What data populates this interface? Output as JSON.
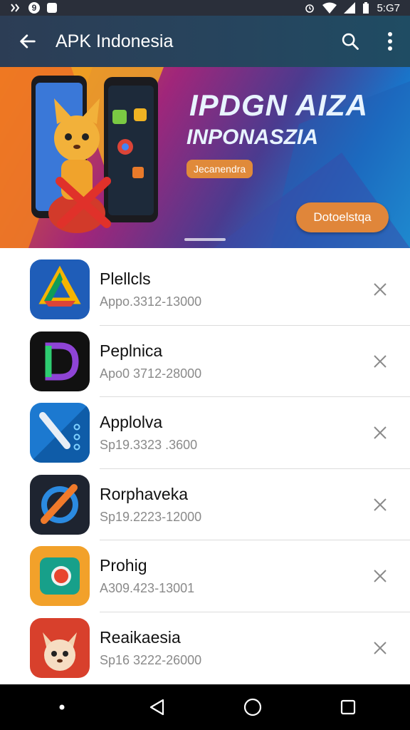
{
  "status_bar": {
    "left_icons": [
      "notification-icon",
      "circle-9-icon",
      "screenshot-icon"
    ],
    "circle_badge": "9",
    "time": "5:G7"
  },
  "app_bar": {
    "title": "APK Indonesia"
  },
  "banner": {
    "headline": "IPDGN AIZA",
    "subheadline": "INPONASZIA",
    "chip_label": "Jecanendra",
    "cta_label": "Dotoelstqa"
  },
  "apps": [
    {
      "name": "Plellcls",
      "meta": "Appo.3312-13000",
      "icon": "drive-icon"
    },
    {
      "name": "Peplnica",
      "meta": "Apo0 3712-28000",
      "icon": "d-letter-icon"
    },
    {
      "name": "Applolva",
      "meta": "Sp19.3323 .3600",
      "icon": "pen-icon"
    },
    {
      "name": "Rorphaveka",
      "meta": "Sp19.2223-12000",
      "icon": "fox-pen-icon"
    },
    {
      "name": "Prohig",
      "meta": "A309.423-13001",
      "icon": "camera-icon"
    },
    {
      "name": "Reaikaesia",
      "meta": "Sp16 3222-26000",
      "icon": "fox-icon"
    }
  ],
  "colors": {
    "app_bar": "#2c3d55",
    "accent_orange": "#e0863a",
    "meta_gray": "#8a8a8a"
  }
}
